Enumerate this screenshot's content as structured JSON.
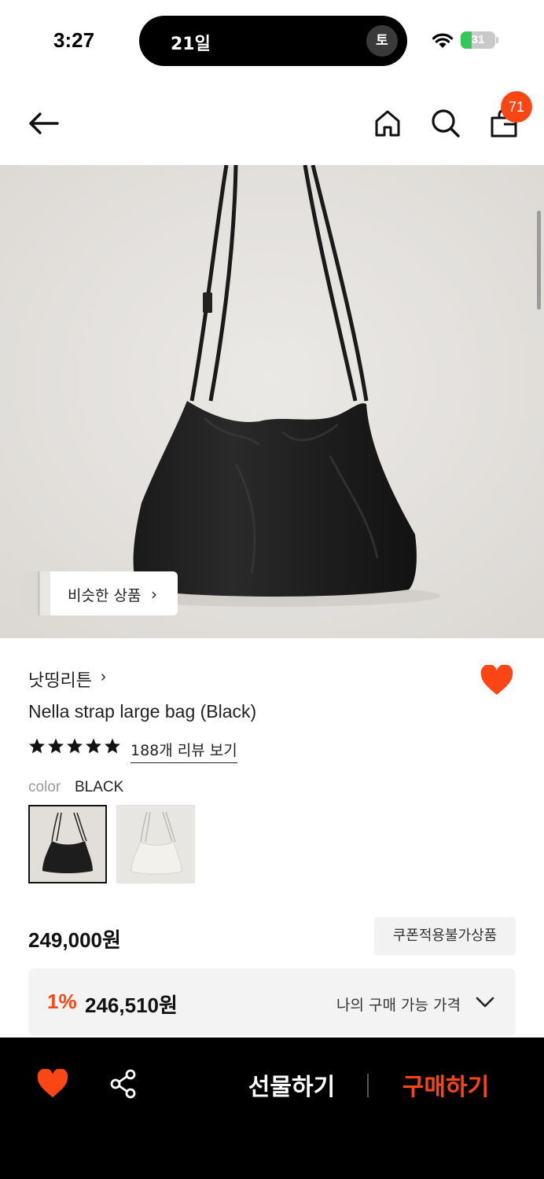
{
  "status_bar": {
    "time": "3:27",
    "island_text": "21일",
    "island_badge": "토",
    "battery_level": "31",
    "battery_fraction": 0.31
  },
  "header": {
    "back_icon": "arrow-left-icon",
    "home_icon": "home-icon",
    "search_icon": "search-icon",
    "cart_icon": "shopping-bag-icon",
    "cart_count": "71"
  },
  "gallery": {
    "similar_products_label": "비슷한 상품"
  },
  "product": {
    "brand": "낫띵리튼",
    "title": "Nella strap large bag (Black)",
    "rating_stars": 5,
    "review_link": "188개 리뷰 보기",
    "color_label": "color",
    "color_value": "BLACK",
    "price": "249,000원",
    "coupon_badge": "쿠폰적용불가상품",
    "best_discount": "1%",
    "best_price": "246,510원",
    "best_price_label": "나의 구매 가능 가격"
  },
  "bottom_bar": {
    "gift_label": "선물하기",
    "buy_label": "구매하기"
  },
  "colors": {
    "accent": "#fa4614",
    "background": "#ffffff",
    "bottom_bar": "#000000"
  }
}
